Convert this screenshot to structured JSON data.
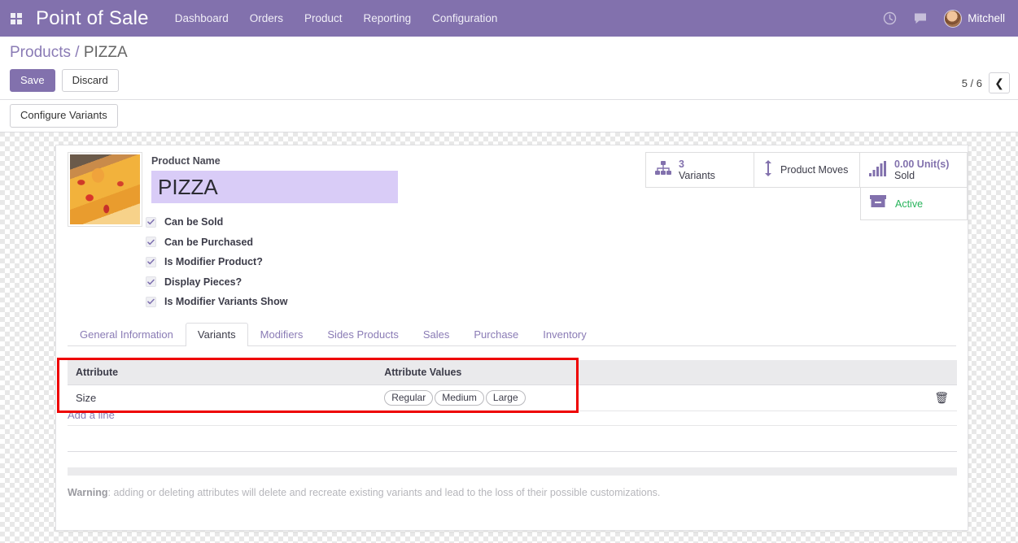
{
  "navbar": {
    "apps_icon": "apps-grid-icon",
    "brand": "Point of Sale",
    "menu": [
      {
        "label": "Dashboard"
      },
      {
        "label": "Orders"
      },
      {
        "label": "Product"
      },
      {
        "label": "Reporting"
      },
      {
        "label": "Configuration"
      }
    ],
    "activity_icon": "clock-icon",
    "messages_icon": "chat-bubble-icon",
    "user_name": "Mitchell",
    "avatar_icon": "user-avatar",
    "bar_color": "#8271ad"
  },
  "control_panel": {
    "breadcrumb_root": "Products",
    "breadcrumb_sep": "/",
    "breadcrumb_current": "PIZZA",
    "save_label": "Save",
    "discard_label": "Discard",
    "pager_text": "5 / 6",
    "pager_prev_icon": "chevron-left-icon"
  },
  "toolbar": {
    "configure_variants_label": "Configure Variants"
  },
  "form": {
    "image_alt": "pizza-product-photo",
    "product_name_label": "Product Name",
    "product_name_value": "PIZZA",
    "checkboxes": [
      {
        "label": "Can be Sold",
        "checked": true
      },
      {
        "label": "Can be Purchased",
        "checked": true
      },
      {
        "label": "Is Modifier Product?",
        "checked": true
      },
      {
        "label": "Display Pieces?",
        "checked": true
      },
      {
        "label": "Is Modifier Variants Show",
        "checked": true
      }
    ]
  },
  "stat_buttons": {
    "variants": {
      "icon": "hierarchy-icon",
      "value": "3",
      "caption": "Variants"
    },
    "product_moves": {
      "icon": "arrows-vertical-icon",
      "caption": "Product Moves"
    },
    "units_sold": {
      "icon": "bar-chart-icon",
      "value": "0.00 Unit(s)",
      "caption": "Sold"
    },
    "archive": {
      "icon": "archive-box-icon",
      "caption": "Active",
      "color": "#27b35b"
    }
  },
  "tabs": [
    {
      "label": "General Information",
      "active": false
    },
    {
      "label": "Variants",
      "active": true
    },
    {
      "label": "Modifiers",
      "active": false
    },
    {
      "label": "Sides Products",
      "active": false
    },
    {
      "label": "Sales",
      "active": false
    },
    {
      "label": "Purchase",
      "active": false
    },
    {
      "label": "Inventory",
      "active": false
    }
  ],
  "attributes_table": {
    "columns": [
      "Attribute",
      "Attribute Values"
    ],
    "rows": [
      {
        "attribute": "Size",
        "values": [
          "Regular",
          "Medium",
          "Large"
        ],
        "delete_icon": "trash-icon"
      }
    ],
    "add_line_label": "Add a line"
  },
  "warning": {
    "prefix": "Warning",
    "text": ": adding or deleting attributes will delete and recreate existing variants and lead to the loss of their possible customizations."
  },
  "annotation": {
    "highlight_color": "#ee0000",
    "target": "attributes-table"
  }
}
